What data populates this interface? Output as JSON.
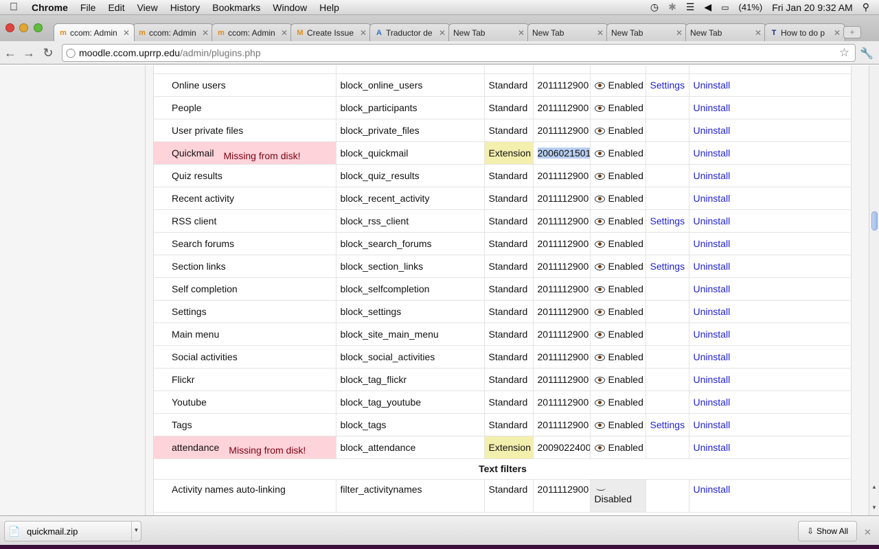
{
  "menubar": {
    "app": "Chrome",
    "items": [
      "File",
      "Edit",
      "View",
      "History",
      "Bookmarks",
      "Window",
      "Help"
    ],
    "battery": "(41%)",
    "datetime": "Fri Jan 20  9:32 AM"
  },
  "tabs": [
    {
      "label": "ccom: Admin",
      "icon_letter": "m",
      "icon_color": "#e38b1a",
      "active": true
    },
    {
      "label": "ccom: Admin",
      "icon_letter": "m",
      "icon_color": "#e38b1a"
    },
    {
      "label": "ccom: Admin",
      "icon_letter": "m",
      "icon_color": "#e38b1a"
    },
    {
      "label": "Create Issue",
      "icon_letter": "M",
      "icon_color": "#e38b1a"
    },
    {
      "label": "Traductor de",
      "icon_letter": "A",
      "icon_color": "#2f6fd0"
    },
    {
      "label": "New Tab",
      "icon_letter": ""
    },
    {
      "label": "New Tab",
      "icon_letter": ""
    },
    {
      "label": "New Tab",
      "icon_letter": ""
    },
    {
      "label": "New Tab",
      "icon_letter": ""
    },
    {
      "label": "How to do p",
      "icon_letter": "T",
      "icon_color": "#1a2c8c"
    }
  ],
  "address": {
    "host": "moodle.ccom.uprrp.edu",
    "path": "/admin/plugins.php"
  },
  "plugins": [
    {
      "name": "Online users",
      "component": "block_online_users",
      "source": "Standard",
      "version": "2011112900",
      "status": "Enabled",
      "settings": "Settings",
      "uninstall": "Uninstall"
    },
    {
      "name": "People",
      "component": "block_participants",
      "source": "Standard",
      "version": "2011112900",
      "status": "Enabled",
      "settings": "",
      "uninstall": "Uninstall"
    },
    {
      "name": "User private files",
      "component": "block_private_files",
      "source": "Standard",
      "version": "2011112900",
      "status": "Enabled",
      "settings": "",
      "uninstall": "Uninstall"
    },
    {
      "name": "Quickmail",
      "missing": "Missing from disk!",
      "component": "block_quickmail",
      "source": "Extension",
      "version": "2006021501",
      "highlight": true,
      "status": "Enabled",
      "settings": "",
      "uninstall": "Uninstall"
    },
    {
      "name": "Quiz results",
      "component": "block_quiz_results",
      "source": "Standard",
      "version": "2011112900",
      "status": "Enabled",
      "settings": "",
      "uninstall": "Uninstall"
    },
    {
      "name": "Recent activity",
      "component": "block_recent_activity",
      "source": "Standard",
      "version": "2011112900",
      "status": "Enabled",
      "settings": "",
      "uninstall": "Uninstall"
    },
    {
      "name": "RSS client",
      "component": "block_rss_client",
      "source": "Standard",
      "version": "2011112900",
      "status": "Enabled",
      "settings": "Settings",
      "uninstall": "Uninstall"
    },
    {
      "name": "Search forums",
      "component": "block_search_forums",
      "source": "Standard",
      "version": "2011112900",
      "status": "Enabled",
      "settings": "",
      "uninstall": "Uninstall"
    },
    {
      "name": "Section links",
      "component": "block_section_links",
      "source": "Standard",
      "version": "2011112900",
      "status": "Enabled",
      "settings": "Settings",
      "uninstall": "Uninstall"
    },
    {
      "name": "Self completion",
      "component": "block_selfcompletion",
      "source": "Standard",
      "version": "2011112900",
      "status": "Enabled",
      "settings": "",
      "uninstall": "Uninstall"
    },
    {
      "name": "Settings",
      "component": "block_settings",
      "source": "Standard",
      "version": "2011112900",
      "status": "Enabled",
      "settings": "",
      "uninstall": "Uninstall"
    },
    {
      "name": "Main menu",
      "component": "block_site_main_menu",
      "source": "Standard",
      "version": "2011112900",
      "status": "Enabled",
      "settings": "",
      "uninstall": "Uninstall"
    },
    {
      "name": "Social activities",
      "component": "block_social_activities",
      "source": "Standard",
      "version": "2011112900",
      "status": "Enabled",
      "settings": "",
      "uninstall": "Uninstall"
    },
    {
      "name": "Flickr",
      "component": "block_tag_flickr",
      "source": "Standard",
      "version": "2011112900",
      "status": "Enabled",
      "settings": "",
      "uninstall": "Uninstall"
    },
    {
      "name": "Youtube",
      "component": "block_tag_youtube",
      "source": "Standard",
      "version": "2011112900",
      "status": "Enabled",
      "settings": "",
      "uninstall": "Uninstall"
    },
    {
      "name": "Tags",
      "component": "block_tags",
      "source": "Standard",
      "version": "2011112900",
      "status": "Enabled",
      "settings": "Settings",
      "uninstall": "Uninstall"
    },
    {
      "name": "attendance",
      "missing": "Missing from disk!",
      "component": "block_attendance",
      "source": "Extension",
      "version": "2009022400",
      "status": "Enabled",
      "settings": "",
      "uninstall": "Uninstall"
    }
  ],
  "section_title": "Text filters",
  "filters": [
    {
      "name": "Activity names auto-linking",
      "component": "filter_activitynames",
      "source": "Standard",
      "version": "2011112900",
      "status": "Disabled",
      "settings": "",
      "uninstall": "Uninstall"
    }
  ],
  "downloads": {
    "file": "quickmail.zip",
    "show_all": "Show All"
  }
}
